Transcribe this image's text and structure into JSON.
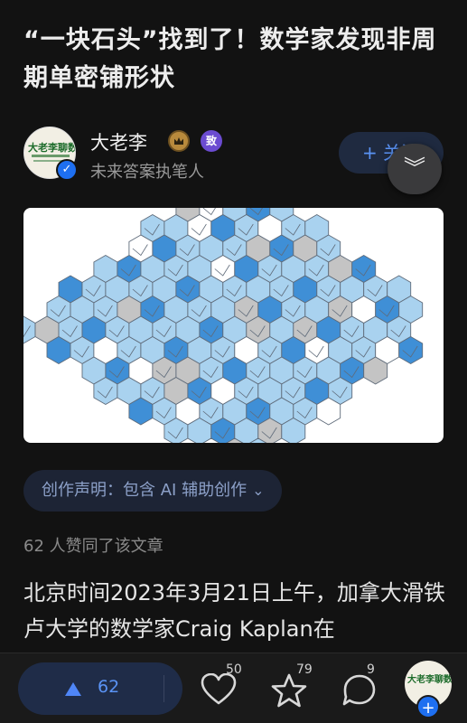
{
  "article": {
    "title": "“一块石头”找到了！数学家发现非周期单密铺形状"
  },
  "author": {
    "name": "大老李",
    "description": "未来答案执笔人",
    "avatar_text": "大老李聊数学",
    "verified_icon": "check-icon",
    "badge1_icon": "crown-badge-icon",
    "badge2_text": "致",
    "follow_label": "+ 关注"
  },
  "collapse": {
    "icon": "double-chevron-down-icon",
    "glyph": "︾"
  },
  "figure": {
    "description_icon": "tiling-image"
  },
  "declaration": {
    "label": "创作声明：包含 AI 辅助创作",
    "chevron": "⌄"
  },
  "likes_text": "62 人赞同了该文章",
  "body": {
    "text": "北京时间2023年3月21日上午，加拿大滑铁卢大学的数学家Craig Kaplan在"
  },
  "bottom_bar": {
    "vote_count": "62",
    "like_count": "50",
    "favorite_count": "79",
    "comment_count": "9",
    "mini_avatar_text": "大老李聊数学",
    "plus": "+"
  },
  "colors": {
    "background": "#121212",
    "accent_blue": "#5a93f5",
    "tile_dark": "#3f8fd6",
    "tile_light": "#a9d2ef",
    "tile_gray": "#c4c4c4"
  }
}
